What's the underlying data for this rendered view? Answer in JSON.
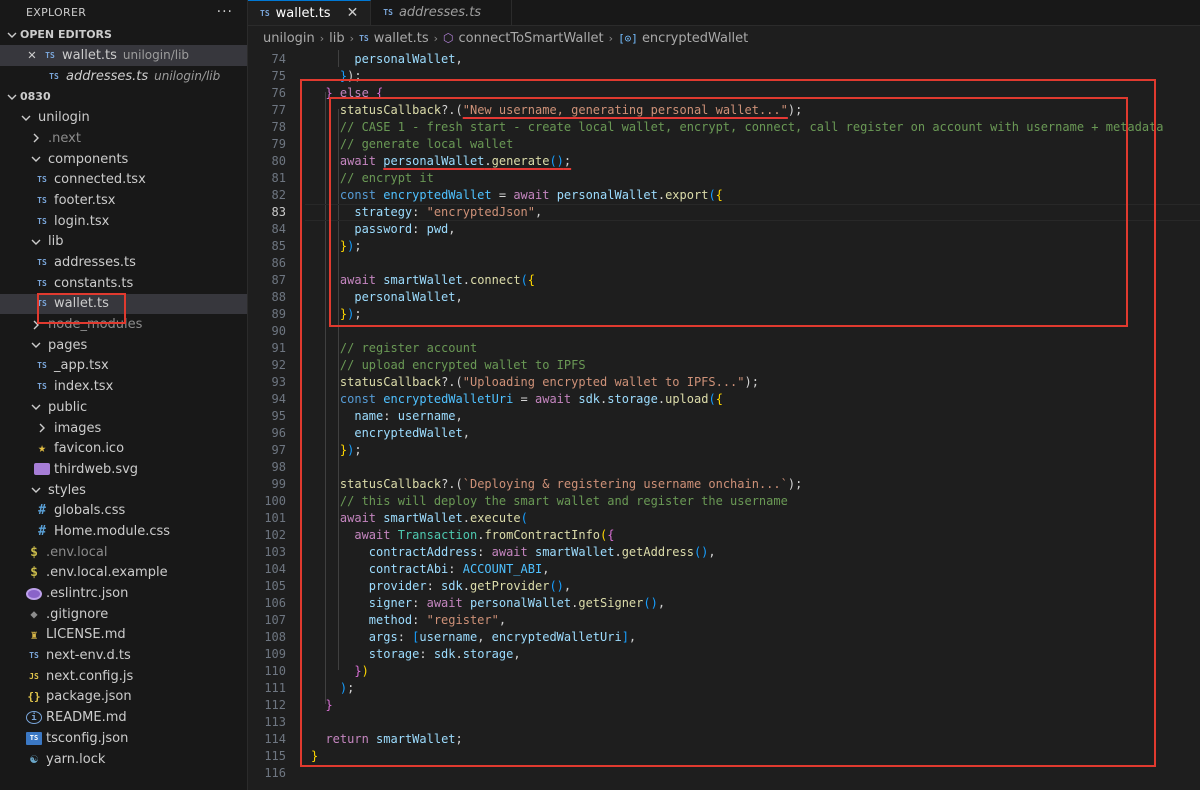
{
  "sidebar": {
    "title": "EXPLORER",
    "more": "···",
    "open_editors": {
      "title": "OPEN EDITORS",
      "items": [
        {
          "name": "wallet.ts",
          "desc": "unilogin/lib"
        },
        {
          "name": "addresses.ts",
          "desc": "unilogin/lib"
        }
      ]
    },
    "folder_title": "0830",
    "tree": [
      "unilogin",
      ".next",
      "components",
      "connected.tsx",
      "footer.tsx",
      "login.tsx",
      "lib",
      "addresses.ts",
      "constants.ts",
      "wallet.ts",
      "node_modules",
      "pages",
      "_app.tsx",
      "index.tsx",
      "public",
      "images",
      "favicon.ico",
      "thirdweb.svg",
      "styles",
      "globals.css",
      "Home.module.css",
      ".env.local",
      ".env.local.example",
      ".eslintrc.json",
      ".gitignore",
      "LICENSE.md",
      "next-env.d.ts",
      "next.config.js",
      "package.json",
      "README.md",
      "tsconfig.json",
      "yarn.lock"
    ]
  },
  "tabs": [
    {
      "label": "wallet.ts",
      "active": true
    },
    {
      "label": "addresses.ts",
      "active": false
    }
  ],
  "breadcrumb": [
    "unilogin",
    "lib",
    "wallet.ts",
    "connectToSmartWallet",
    "encryptedWallet"
  ],
  "code": {
    "current_line": 83,
    "lines": [
      {
        "n": "74"
      },
      {
        "n": "75"
      },
      {
        "n": "76"
      },
      {
        "n": "77"
      },
      {
        "n": "78"
      },
      {
        "n": "79"
      },
      {
        "n": "80"
      },
      {
        "n": "81"
      },
      {
        "n": "82"
      },
      {
        "n": "83"
      },
      {
        "n": "84"
      },
      {
        "n": "85"
      },
      {
        "n": "86"
      },
      {
        "n": "87"
      },
      {
        "n": "88"
      },
      {
        "n": "89"
      },
      {
        "n": "90"
      },
      {
        "n": "91"
      },
      {
        "n": "92"
      },
      {
        "n": "93"
      },
      {
        "n": "94"
      },
      {
        "n": "95"
      },
      {
        "n": "96"
      },
      {
        "n": "97"
      },
      {
        "n": "98"
      },
      {
        "n": "99"
      },
      {
        "n": "100"
      },
      {
        "n": "101"
      },
      {
        "n": "102"
      },
      {
        "n": "103"
      },
      {
        "n": "104"
      },
      {
        "n": "105"
      },
      {
        "n": "106"
      },
      {
        "n": "107"
      },
      {
        "n": "108"
      },
      {
        "n": "109"
      },
      {
        "n": "110"
      },
      {
        "n": "111"
      },
      {
        "n": "112"
      },
      {
        "n": "113"
      },
      {
        "n": "114"
      },
      {
        "n": "115"
      },
      {
        "n": "116"
      }
    ]
  },
  "tokens": {
    "l74": {
      "a": "personalWallet",
      "b": ","
    },
    "l75": {
      "a": "}",
      "b": ");"
    },
    "l76": {
      "a": "} ",
      "b": "else",
      "c": " {"
    },
    "l77": {
      "a": "statusCallback",
      "b": "?.(",
      "c": "\"New username, generating personal wallet...\"",
      "d": ");"
    },
    "l78": "// CASE 1 - fresh start - create local wallet, encrypt, connect, call register on account with username + metadata",
    "l79": "// generate local wallet",
    "l80": {
      "a": "await",
      "b": "personalWallet",
      "c": ".",
      "d": "generate",
      "e": "()",
      "f": ";"
    },
    "l81": "// encrypt it",
    "l82": {
      "a": "const",
      "b": "encryptedWallet",
      "c": " = ",
      "d": "await",
      "e": "personalWallet",
      "f": ".",
      "g": "export",
      "h": "(",
      "i": "{"
    },
    "l83": {
      "a": "strategy",
      "b": ": ",
      "c": "\"encryptedJson\"",
      "d": ","
    },
    "l84": {
      "a": "password",
      "b": ": ",
      "c": "pwd",
      "d": ","
    },
    "l85": {
      "a": "}",
      "b": ")",
      "c": ";"
    },
    "l87": {
      "a": "await",
      "b": "smartWallet",
      "c": ".",
      "d": "connect",
      "e": "(",
      "f": "{"
    },
    "l88": {
      "a": "personalWallet",
      "b": ","
    },
    "l89": {
      "a": "}",
      "b": ")",
      "c": ";"
    },
    "l91": "// register account",
    "l92": "// upload encrypted wallet to IPFS",
    "l93": {
      "a": "statusCallback",
      "b": "?.(",
      "c": "\"Uploading encrypted wallet to IPFS...\"",
      "d": ");"
    },
    "l94": {
      "a": "const",
      "b": "encryptedWalletUri",
      "c": " = ",
      "d": "await",
      "e": "sdk",
      "f": ".",
      "g": "storage",
      "h": ".",
      "i": "upload",
      "j": "(",
      "k": "{"
    },
    "l95": {
      "a": "name",
      "b": ": ",
      "c": "username",
      "d": ","
    },
    "l96": {
      "a": "encryptedWallet",
      "b": ","
    },
    "l97": {
      "a": "}",
      "b": ")",
      "c": ";"
    },
    "l99": {
      "a": "statusCallback",
      "b": "?.(",
      "c": "`Deploying & registering username onchain...`",
      "d": ");"
    },
    "l100": "// this will deploy the smart wallet and register the username",
    "l101": {
      "a": "await",
      "b": "smartWallet",
      "c": ".",
      "d": "execute",
      "e": "("
    },
    "l102": {
      "a": "await",
      "b": "Transaction",
      "c": ".",
      "d": "fromContractInfo",
      "e": "(",
      "f": "{"
    },
    "l103": {
      "a": "contractAddress",
      "b": ": ",
      "c": "await",
      "d": "smartWallet",
      "e": ".",
      "f": "getAddress",
      "g": "()",
      "h": ","
    },
    "l104": {
      "a": "contractAbi",
      "b": ": ",
      "c": "ACCOUNT_ABI",
      "d": ","
    },
    "l105": {
      "a": "provider",
      "b": ": ",
      "c": "sdk",
      "d": ".",
      "e": "getProvider",
      "f": "()",
      "g": ","
    },
    "l106": {
      "a": "signer",
      "b": ": ",
      "c": "await",
      "d": "personalWallet",
      "e": ".",
      "f": "getSigner",
      "g": "()",
      "h": ","
    },
    "l107": {
      "a": "method",
      "b": ": ",
      "c": "\"register\"",
      "d": ","
    },
    "l108": {
      "a": "args",
      "b": ": ",
      "c": "[",
      "d": "username",
      "e": ", ",
      "f": "encryptedWalletUri",
      "g": "]",
      "h": ","
    },
    "l109": {
      "a": "storage",
      "b": ": ",
      "c": "sdk",
      "d": ".",
      "e": "storage",
      "f": ","
    },
    "l110": {
      "a": "}",
      "b": ")"
    },
    "l111": {
      "a": ")",
      "b": ";"
    },
    "l112": {
      "a": "}"
    },
    "l114": {
      "a": "return",
      "b": "smartWallet",
      "c": ";"
    },
    "l115": {
      "a": "}"
    }
  },
  "colors": {
    "annotation": "#e03a2f",
    "background": "#1e1e1e",
    "sidebar": "#181818",
    "accent": "#0078d4"
  }
}
